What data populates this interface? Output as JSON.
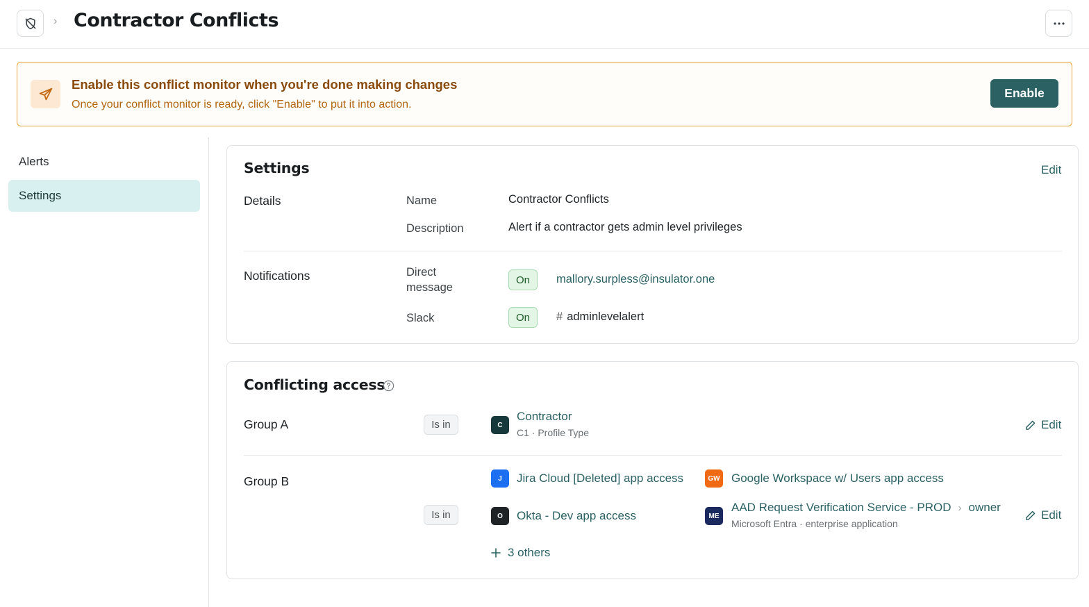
{
  "header": {
    "title": "Contractor Conflicts",
    "app_icon": "shield-off-icon",
    "more_icon": "more-horizontal-icon"
  },
  "banner": {
    "title": "Enable this conflict monitor when you're done making changes",
    "subtitle": "Once your conflict monitor is ready, click \"Enable\" to put it into action.",
    "button_label": "Enable",
    "icon": "send-icon"
  },
  "sidebar": {
    "items": [
      {
        "label": "Alerts",
        "active": false
      },
      {
        "label": "Settings",
        "active": true
      }
    ]
  },
  "settings": {
    "title": "Settings",
    "edit_label": "Edit",
    "details": {
      "section_label": "Details",
      "name_label": "Name",
      "name_value": "Contractor Conflicts",
      "description_label": "Description",
      "description_value": "Alert if a contractor gets admin level privileges"
    },
    "notifications": {
      "section_label": "Notifications",
      "direct_message_label_1": "Direct",
      "direct_message_label_2": "message",
      "direct_message_status": "On",
      "direct_message_target": "mallory.surpless@insulator.one",
      "slack_label": "Slack",
      "slack_status": "On",
      "slack_hash": "#",
      "slack_channel": "adminlevelalert"
    }
  },
  "conflicting_access": {
    "title": "Conflicting access",
    "group_a": {
      "label": "Group A",
      "relation": "Is in",
      "edit_label": "Edit",
      "resource": {
        "icon_text": "C",
        "name": "Contractor",
        "subtitle": "C1 · Profile Type",
        "icon_color": "#163a3b"
      }
    },
    "group_b": {
      "label": "Group B",
      "relation": "Is in",
      "edit_label": "Edit",
      "resources": [
        {
          "icon_text": "J",
          "name": "Jira Cloud [Deleted] app access",
          "icon_color": "#1d6ff2"
        },
        {
          "icon_text": "GW",
          "name": "Google Workspace w/ Users app access",
          "icon_color": "#f06a14"
        },
        {
          "icon_text": "O",
          "name": "Okta - Dev app access",
          "icon_color": "#1f2326"
        },
        {
          "icon_text": "ME",
          "name": "AAD Request Verification Service - PROD",
          "role": "owner",
          "subtitle": "Microsoft Entra · enterprise application",
          "icon_color": "#1a2a5e"
        }
      ],
      "others_label": "3 others"
    }
  },
  "colors": {
    "accent": "#2b6163",
    "banner_border": "#e8a23c",
    "sidebar_active": "#d8f0f0"
  }
}
